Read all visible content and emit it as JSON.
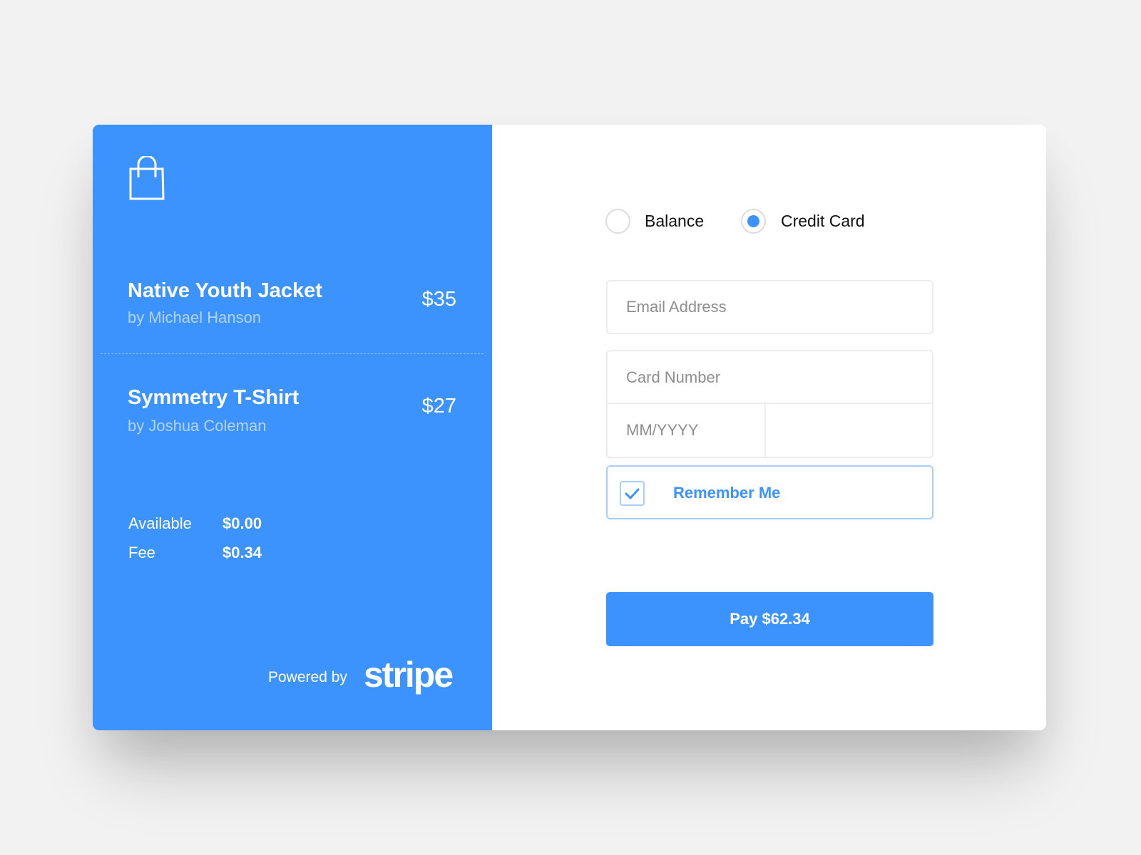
{
  "colors": {
    "accent": "#3d93fe",
    "background": "#f2f2f2",
    "panel": "#3d93fe"
  },
  "icons": {
    "bag": "shopping-bag-icon",
    "check": "checkmark-icon"
  },
  "order": {
    "items": [
      {
        "title": "Native Youth Jacket",
        "author": "by Michael Hanson",
        "price": "$35"
      },
      {
        "title": "Symmetry T-Shirt",
        "author": "by Joshua Coleman",
        "price": "$27"
      }
    ],
    "summary": [
      {
        "label": "Available",
        "value": "$0.00"
      },
      {
        "label": "Fee",
        "value": "$0.34"
      }
    ],
    "powered_by": "Powered by",
    "brand": "stripe"
  },
  "payment": {
    "methods": [
      {
        "label": "Balance",
        "selected": false
      },
      {
        "label": "Credit Card",
        "selected": true
      }
    ],
    "email_placeholder": "Email Address",
    "card_placeholder": "Card Number",
    "expiry_placeholder": "MM/YYYY",
    "cvc_placeholder": "",
    "remember_label": "Remember Me",
    "remember_checked": true,
    "pay_label": "Pay $62.34"
  }
}
